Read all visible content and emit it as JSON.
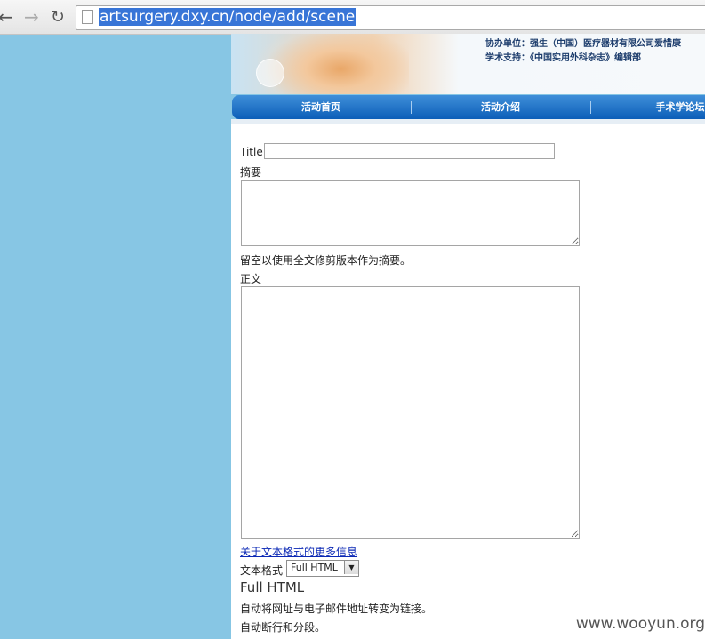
{
  "browser": {
    "back_icon": "back-arrow-icon",
    "forward_icon": "forward-arrow-icon",
    "reload_icon": "reload-icon",
    "url": "artsurgery.dxy.cn/node/add/scene"
  },
  "banner": {
    "sponsor_line1": "协办单位：强生（中国）医疗器材有限公司爱惜康",
    "sponsor_line2": "学术支持：《中国实用外科杂志》编辑部"
  },
  "nav": {
    "items": [
      "活动首页",
      "活动介绍",
      "手术学论坛"
    ]
  },
  "form": {
    "title_label": "Title",
    "title_value": "",
    "summary_label": "摘要",
    "summary_value": "",
    "summary_help": "留空以使用全文修剪版本作为摘要。",
    "body_label": "正文",
    "body_value": "",
    "format_link": "关于文本格式的更多信息",
    "format_label": "文本格式",
    "format_selected": "Full HTML",
    "format_name": "Full HTML",
    "format_tips": [
      "自动将网址与电子邮件地址转变为链接。",
      "自动断行和分段。"
    ]
  },
  "watermark": "www.wooyun.org"
}
